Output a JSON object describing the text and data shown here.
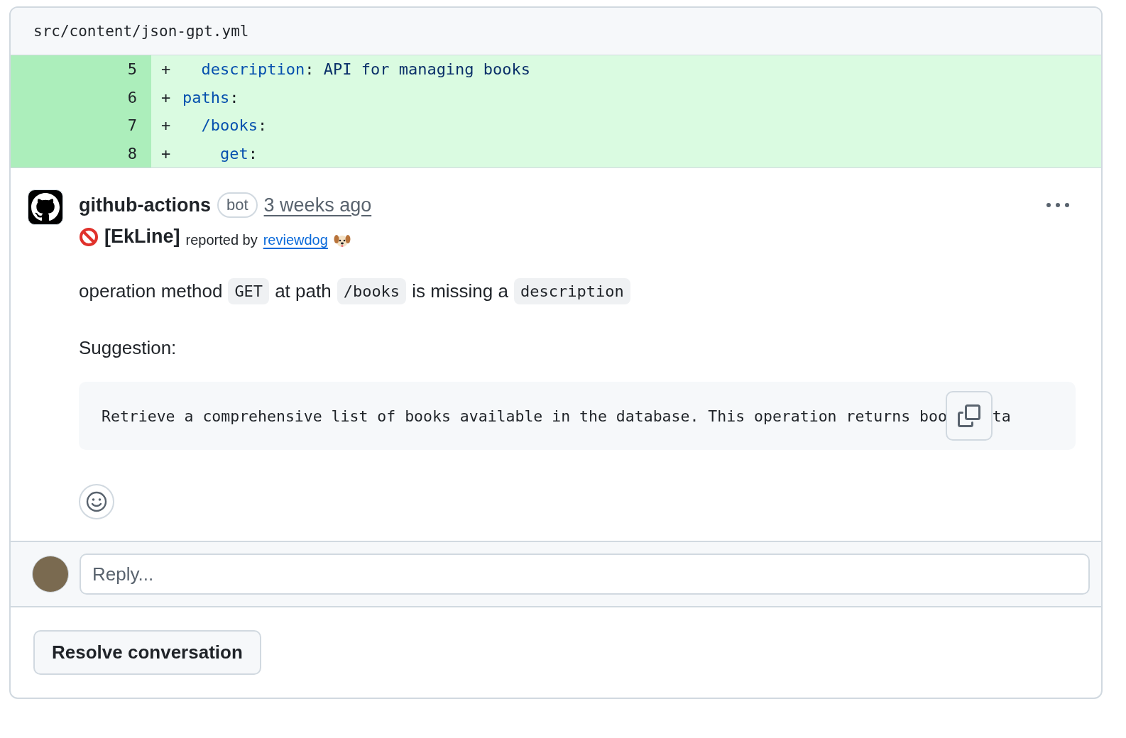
{
  "file": {
    "path": "src/content/json-gpt.yml"
  },
  "diff": [
    {
      "number": "5",
      "sign": "+",
      "segments": [
        {
          "kind": "key",
          "text": "  description"
        },
        {
          "kind": "punct",
          "text": ": "
        },
        {
          "kind": "string",
          "text": "API for managing books"
        }
      ]
    },
    {
      "number": "6",
      "sign": "+",
      "segments": [
        {
          "kind": "key",
          "text": "paths"
        },
        {
          "kind": "punct",
          "text": ":"
        }
      ]
    },
    {
      "number": "7",
      "sign": "+",
      "segments": [
        {
          "kind": "key",
          "text": "  /books"
        },
        {
          "kind": "punct",
          "text": ":"
        }
      ]
    },
    {
      "number": "8",
      "sign": "+",
      "segments": [
        {
          "kind": "key",
          "text": "    get"
        },
        {
          "kind": "punct",
          "text": ":"
        }
      ]
    }
  ],
  "comment": {
    "author": "github-actions",
    "badge": "bot",
    "time": "3 weeks ago",
    "tool": "[EkLine]",
    "reported_by": "reported by",
    "reporter": "reviewdog",
    "message": [
      {
        "kind": "text",
        "text": "operation method"
      },
      {
        "kind": "code",
        "text": "GET"
      },
      {
        "kind": "text",
        "text": "at path"
      },
      {
        "kind": "code",
        "text": "/books"
      },
      {
        "kind": "text",
        "text": "is missing a"
      },
      {
        "kind": "code",
        "text": "description"
      }
    ],
    "suggestion_label": "Suggestion:",
    "suggestion_code": "Retrieve a comprehensive list of books available in the database. This operation returns boo",
    "suggestion_code_tail": "ta"
  },
  "reply": {
    "placeholder": "Reply..."
  },
  "buttons": [
    "Resolve conversation"
  ]
}
